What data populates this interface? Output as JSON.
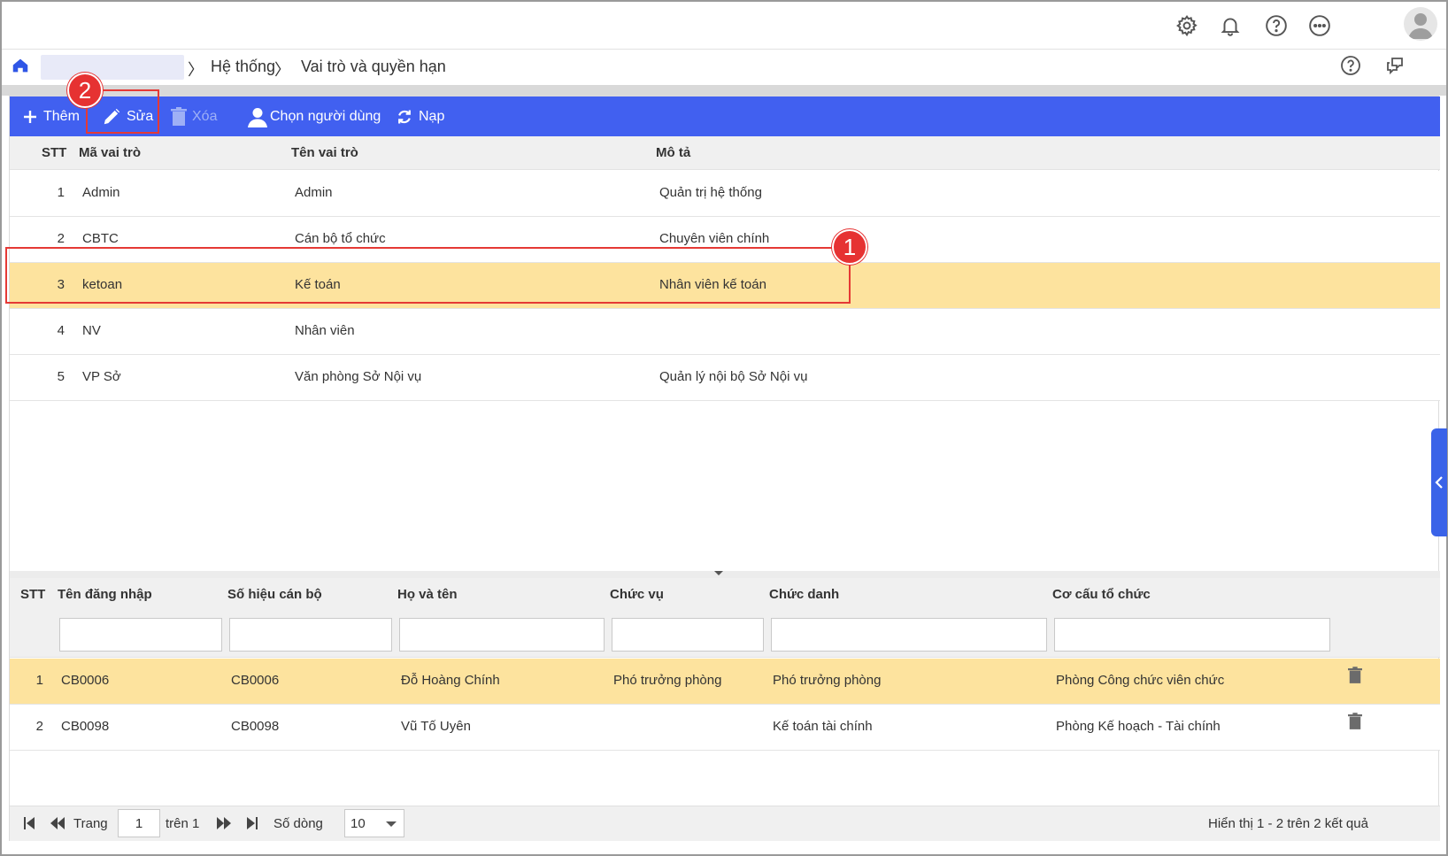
{
  "breadcrumb": {
    "items": [
      "Hệ thống",
      "Vai trò và quyền hạn"
    ]
  },
  "toolbar": {
    "add_label": "Thêm",
    "edit_label": "Sửa",
    "delete_label": "Xóa",
    "choose_user_label": "Chọn người dùng",
    "reload_label": "Nạp"
  },
  "roles_grid": {
    "headers": {
      "stt": "STT",
      "code": "Mã vai trò",
      "name": "Tên vai trò",
      "desc": "Mô tả"
    },
    "rows": [
      {
        "stt": "1",
        "code": "Admin",
        "name": "Admin",
        "desc": "Quản trị hệ thống"
      },
      {
        "stt": "2",
        "code": "CBTC",
        "name": "Cán bộ tổ chức",
        "desc": "Chuyên viên chính"
      },
      {
        "stt": "3",
        "code": "ketoan",
        "name": "Kế toán",
        "desc": "Nhân viên kế toán"
      },
      {
        "stt": "4",
        "code": "NV",
        "name": "Nhân viên",
        "desc": ""
      },
      {
        "stt": "5",
        "code": "VP Sở",
        "name": "Văn phòng Sở Nội vụ",
        "desc": "Quản lý nội bộ Sở Nội vụ"
      }
    ],
    "selected_row": 2
  },
  "users_grid": {
    "headers": {
      "stt": "STT",
      "username": "Tên đăng nhập",
      "staff_id": "Số hiệu cán bộ",
      "fullname": "Họ và tên",
      "position": "Chức vụ",
      "title": "Chức danh",
      "org": "Cơ cấu tổ chức"
    },
    "rows": [
      {
        "stt": "1",
        "username": "CB0006",
        "staff_id": "CB0006",
        "fullname": "Đỗ Hoàng Chính",
        "position": "Phó trưởng phòng",
        "title": "Phó trưởng phòng",
        "org": "Phòng Công chức viên chức"
      },
      {
        "stt": "2",
        "username": "CB0098",
        "staff_id": "CB0098",
        "fullname": "Vũ Tố Uyên",
        "position": "",
        "title": "Kế toán tài chính",
        "org": "Phòng Kế hoạch - Tài chính"
      }
    ]
  },
  "pager": {
    "page_label": "Trang",
    "page_value": "1",
    "of_label": "trên 1",
    "rows_label": "Số dòng",
    "rows_value": "10",
    "summary": "Hiển thị 1 - 2 trên 2 kết quả"
  },
  "annotations": {
    "badge1": "1",
    "badge2": "2"
  },
  "colors": {
    "toolbar": "#4160f0",
    "selected_row": "#fde39e",
    "annotation": "#e53935"
  }
}
